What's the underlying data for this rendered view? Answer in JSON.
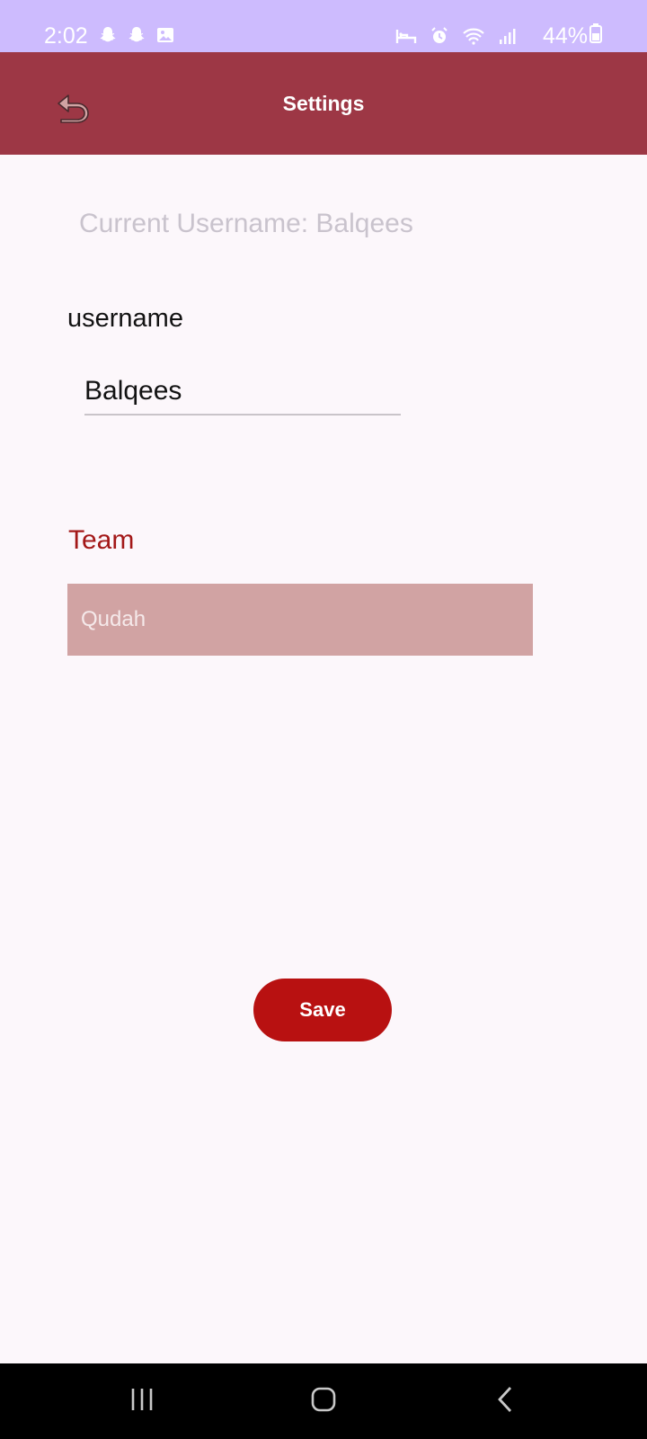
{
  "status_bar": {
    "time": "2:02",
    "battery": "44%",
    "left_icons": [
      "snapchat-icon",
      "snapchat-icon",
      "image-icon"
    ],
    "right_icons": [
      "sleep-mode-icon",
      "alarm-icon",
      "wifi-icon",
      "signal-icon"
    ],
    "background_color": "#CDBBFE"
  },
  "app_bar": {
    "title": "Settings",
    "back_icon": "undo-back-icon",
    "background_color": "#9D3745"
  },
  "current_username_text": "Current Username: Balqees",
  "username": {
    "label": "username",
    "value": "Balqees"
  },
  "team": {
    "label": "Team",
    "value": "Qudah"
  },
  "save_button": {
    "label": "Save",
    "color": "#B81111"
  },
  "nav_bar": {
    "items": [
      "recent-apps-icon",
      "home-icon",
      "back-icon"
    ]
  }
}
